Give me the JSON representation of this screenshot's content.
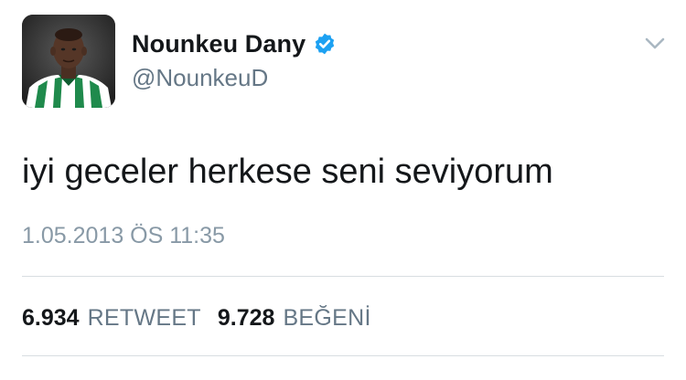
{
  "author": {
    "display_name": "Nounkeu Dany",
    "handle": "@NounkeuD",
    "verified": true,
    "avatar_icon": "profile-photo-green-white-striped-jersey"
  },
  "header": {
    "menu_icon": "chevron-down-icon"
  },
  "tweet": {
    "text": "iyi geceler herkese seni seviyorum",
    "timestamp": "1.05.2013 ÖS 11:35"
  },
  "stats": {
    "retweet_count": "6.934",
    "retweet_label": "RETWEET",
    "like_count": "9.728",
    "like_label": "BEĞENİ"
  },
  "colors": {
    "text_primary": "#14171a",
    "text_secondary": "#657786",
    "text_muted": "#8899a6",
    "verified_blue": "#1da1f2",
    "divider": "#d8dde1"
  }
}
